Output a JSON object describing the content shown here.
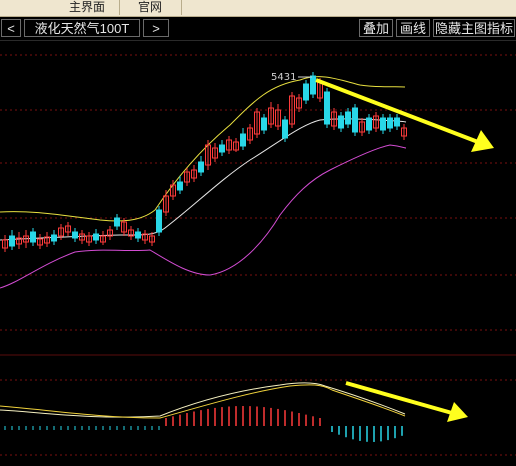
{
  "topbar": {
    "tabs": [
      {
        "label": "主界面"
      },
      {
        "label": "官网"
      }
    ]
  },
  "toolbar": {
    "prev_symbol": "<",
    "symbol_name": "液化天然气100T",
    "next_symbol": ">",
    "overlay_label": "叠加",
    "draw_label": "画线",
    "hide_indicator_label": "隐藏主图指标"
  },
  "chart": {
    "peak_price_label": "5431",
    "colors": {
      "up": "#ff3b3b",
      "down": "#29d7e8",
      "boll_upper": "#e8e040",
      "boll_mid": "#e6e6e6",
      "boll_lower": "#d24cd2",
      "trend_arrow": "#ffff1e",
      "grid": "#7a1010"
    }
  }
}
